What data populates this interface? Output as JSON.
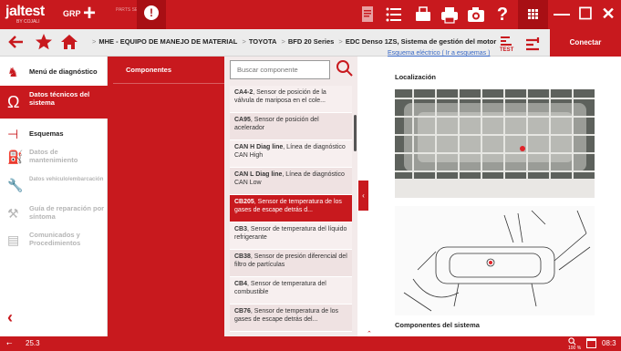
{
  "app": {
    "logo": "jaltest",
    "logo_sub": "BY COJALI",
    "grp_label": "GRP",
    "parts_label": "PARTS SEARCH",
    "alert_glyph": "!"
  },
  "toolbar": {
    "icons": [
      "document-icon",
      "list-icon",
      "printer-icon",
      "print-icon",
      "camera-icon",
      "help-icon",
      "grid-icon",
      "minimize-icon",
      "maximize-icon",
      "close-icon"
    ],
    "help_glyph": "?",
    "minimize_glyph": "—",
    "maximize_glyph": "☐",
    "close_glyph": "✕"
  },
  "breadcrumb": {
    "items": [
      "MHE - EQUIPO DE MANEJO DE MATERIAL",
      "TOYOTA",
      "BFD 20 Series",
      "EDC Denso 1ZS, Sistema de gestión del motor"
    ],
    "separator": ">",
    "test_label": "TEST",
    "connect_label": "Conectar"
  },
  "sidebar": {
    "items": [
      {
        "label": "Menú de diagnóstico",
        "icon": "diagnostic-menu-icon",
        "state": "normal"
      },
      {
        "label": "Datos técnicos del sistema",
        "icon": "omega-icon",
        "state": "active"
      },
      {
        "label": "Esquemas",
        "icon": "schema-icon",
        "state": "normal"
      },
      {
        "label": "Datos de mantenimiento",
        "icon": "oil-can-icon",
        "state": "disabled"
      },
      {
        "label": "Datos vehículo/embarcación",
        "icon": "wrench-icon",
        "state": "disabled"
      },
      {
        "label": "Guía de reparación por síntoma",
        "icon": "repair-guide-icon",
        "state": "disabled"
      },
      {
        "label": "Comunicados y Procedimientos",
        "icon": "document-icon",
        "state": "disabled"
      }
    ],
    "back_glyph": "‹"
  },
  "components": {
    "header": "Componentes",
    "search_placeholder": "Buscar componente",
    "items": [
      {
        "code": "CA4-2",
        "desc": ", Sensor de posición de la válvula de mariposa en el cole...",
        "selected": false
      },
      {
        "code": "CA95",
        "desc": ", Sensor de posición del acelerador",
        "selected": false
      },
      {
        "code": "CAN H Diag line",
        "desc": ", Línea de diagnóstico CAN High",
        "selected": false
      },
      {
        "code": "CAN L Diag line",
        "desc": ", Línea de diagnóstico CAN Low",
        "selected": false
      },
      {
        "code": "CB205",
        "desc": ", Sensor de temperatura de los gases de escape detrás d...",
        "selected": true
      },
      {
        "code": "CB3",
        "desc": ", Sensor de temperatura del líquido refrigerante",
        "selected": false
      },
      {
        "code": "CB38",
        "desc": ", Sensor de presión diferencial del filtro de partículas",
        "selected": false
      },
      {
        "code": "CB4",
        "desc": ", Sensor de temperatura del combustible",
        "selected": false
      },
      {
        "code": "CB76",
        "desc": ", Sensor de temperatura de los gases de escape detrás del...",
        "selected": false
      }
    ]
  },
  "detail": {
    "link_text": "Esquema eléctrico ( Ir a esquemas )",
    "localization_title": "Localización",
    "system_components_title": "Componentes del sistema"
  },
  "status": {
    "version": "25.3",
    "zoom": "100 %",
    "time": "08:3"
  },
  "colors": {
    "brand_red": "#c8191e",
    "dark_red": "#a80f14",
    "selected_item": "#c8191e"
  }
}
